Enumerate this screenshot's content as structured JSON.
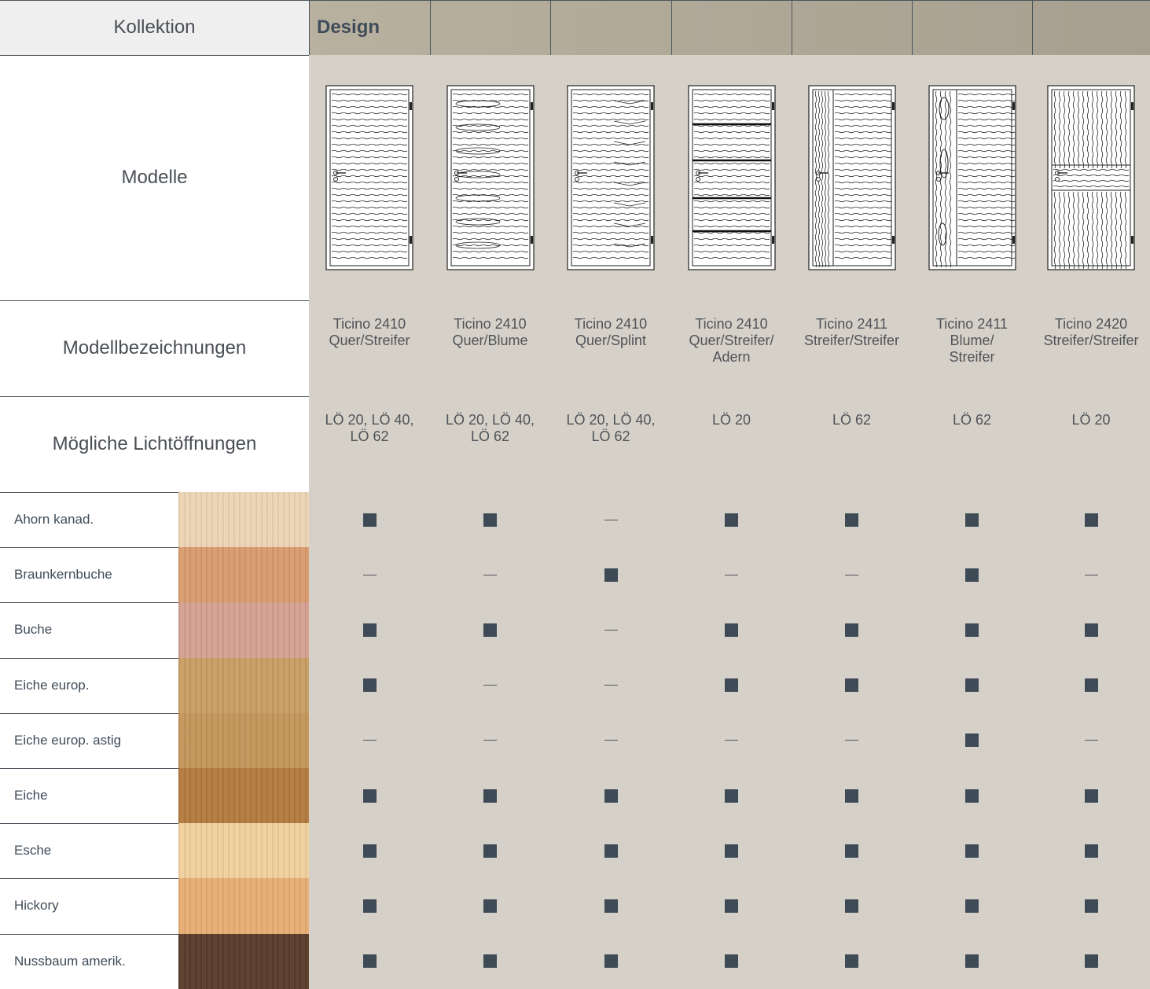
{
  "header": {
    "kollektion_label": "Kollektion",
    "design_label": "Design"
  },
  "row_labels": {
    "modelle": "Modelle",
    "modellbezeichnungen": "Modellbezeichnungen",
    "lichtoeffnungen": "Mögliche Lichtöffnungen"
  },
  "models": [
    {
      "name_lines": [
        "Ticino 2410",
        "Quer/Streifer",
        ""
      ],
      "openings_lines": [
        "LÖ 20, LÖ 40,",
        "LÖ 62"
      ],
      "door_icon": "door-quer-streifer-icon"
    },
    {
      "name_lines": [
        "Ticino 2410",
        "Quer/Blume",
        ""
      ],
      "openings_lines": [
        "LÖ 20, LÖ 40,",
        "LÖ 62"
      ],
      "door_icon": "door-quer-blume-icon"
    },
    {
      "name_lines": [
        "Ticino 2410",
        "Quer/Splint",
        ""
      ],
      "openings_lines": [
        "LÖ 20, LÖ 40,",
        "LÖ 62"
      ],
      "door_icon": "door-quer-splint-icon"
    },
    {
      "name_lines": [
        "Ticino 2410",
        "Quer/Streifer/",
        "Adern"
      ],
      "openings_lines": [
        "LÖ 20",
        ""
      ],
      "door_icon": "door-quer-streifer-adern-icon"
    },
    {
      "name_lines": [
        "Ticino 2411",
        "Streifer/Streifer",
        ""
      ],
      "openings_lines": [
        "LÖ 62",
        ""
      ],
      "door_icon": "door-streifer-streifer-icon"
    },
    {
      "name_lines": [
        "Ticino 2411",
        "Blume/",
        "Streifer"
      ],
      "openings_lines": [
        "LÖ 62",
        ""
      ],
      "door_icon": "door-blume-streifer-icon"
    },
    {
      "name_lines": [
        "Ticino 2420",
        "Streifer/Streifer",
        ""
      ],
      "openings_lines": [
        "LÖ 20",
        ""
      ],
      "door_icon": "door-2420-streifer-streifer-icon"
    }
  ],
  "woods": [
    {
      "name": "Ahorn kanad.",
      "swatch": "#ecd3b4",
      "availability": [
        true,
        true,
        false,
        true,
        true,
        true,
        true
      ]
    },
    {
      "name": "Braunkernbuche",
      "swatch": "#d99a6d",
      "availability": [
        false,
        false,
        true,
        false,
        false,
        true,
        false
      ]
    },
    {
      "name": "Buche",
      "swatch": "#d4a090",
      "availability": [
        true,
        true,
        false,
        true,
        true,
        true,
        true
      ]
    },
    {
      "name": "Eiche europ.",
      "swatch": "#c79d63",
      "availability": [
        true,
        false,
        false,
        true,
        true,
        true,
        true
      ]
    },
    {
      "name": "Eiche europ. astig",
      "swatch": "#c4955a",
      "availability": [
        false,
        false,
        false,
        false,
        false,
        true,
        false
      ]
    },
    {
      "name": "Eiche",
      "swatch": "#b27a3e",
      "availability": [
        true,
        true,
        true,
        true,
        true,
        true,
        true
      ]
    },
    {
      "name": "Esche",
      "swatch": "#efcf9c",
      "availability": [
        true,
        true,
        true,
        true,
        true,
        true,
        true
      ]
    },
    {
      "name": "Hickory",
      "swatch": "#e6ad73",
      "availability": [
        true,
        true,
        true,
        true,
        true,
        true,
        true
      ]
    },
    {
      "name": "Nussbaum amerik.",
      "swatch": "#5a3b2a",
      "availability": [
        true,
        true,
        true,
        true,
        true,
        true,
        true
      ]
    }
  ],
  "colors": {
    "design_header": "#aba391",
    "cell_background": "#d6d1c8",
    "mark": "#3e4a55",
    "grid_line": "#4c555e"
  }
}
